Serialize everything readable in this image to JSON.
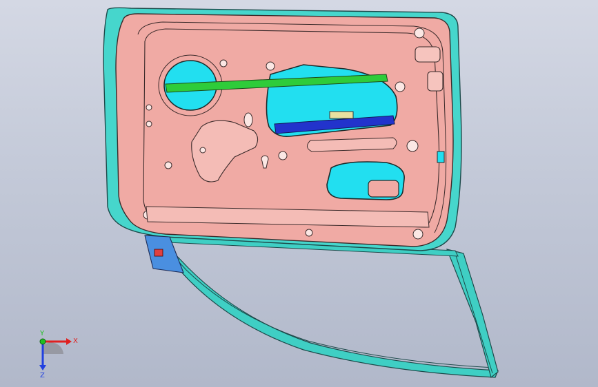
{
  "viewport": {
    "background_top": "#d4d8e4",
    "background_bottom": "#b1b8ca"
  },
  "model": {
    "colors": {
      "inner_panel": "#f0aaa4",
      "inner_panel_edge": "#3a2a2a",
      "outer_frame": "#46d6cc",
      "window_frame": "#3fcfc4",
      "opening": "#22dff0",
      "glass_rail_green": "#2ecc3a",
      "glass_rail_blue": "#2233cc",
      "hinge_bracket": "#4a8fe0"
    }
  },
  "triad": {
    "x_label": "X",
    "y_label": "Y",
    "z_label": "Z",
    "x_color": "#e02020",
    "y_color": "#20c020",
    "z_color": "#2040e0"
  }
}
